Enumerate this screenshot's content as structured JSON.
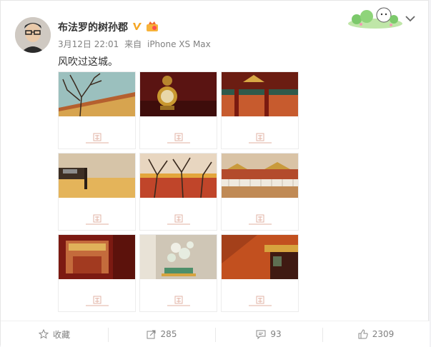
{
  "post": {
    "username": "布法罗的树孙郡",
    "time": "3月12日 22:01",
    "source_prefix": "来自",
    "source": "iPhone XS Max",
    "text": "风吹过这城。"
  },
  "images": [
    {
      "alt": "barren trees over red palace wall"
    },
    {
      "alt": "ornate gilded clock"
    },
    {
      "alt": "red palace hall eaves"
    },
    {
      "alt": "golden floor interior"
    },
    {
      "alt": "tree branches over red wall"
    },
    {
      "alt": "white marble balustrade terrace"
    },
    {
      "alt": "red gate corridor view"
    },
    {
      "alt": "jade bonsai ornament"
    },
    {
      "alt": "red wall corner with shadow"
    }
  ],
  "actions": {
    "favorite_label": "收藏",
    "repost_count": "285",
    "comment_count": "93",
    "like_count": "2309"
  },
  "colors": {
    "card_bg": "#ffffff",
    "page_bg": "#f2f2f5",
    "verified": "#f5a623",
    "meta": "#808080"
  }
}
